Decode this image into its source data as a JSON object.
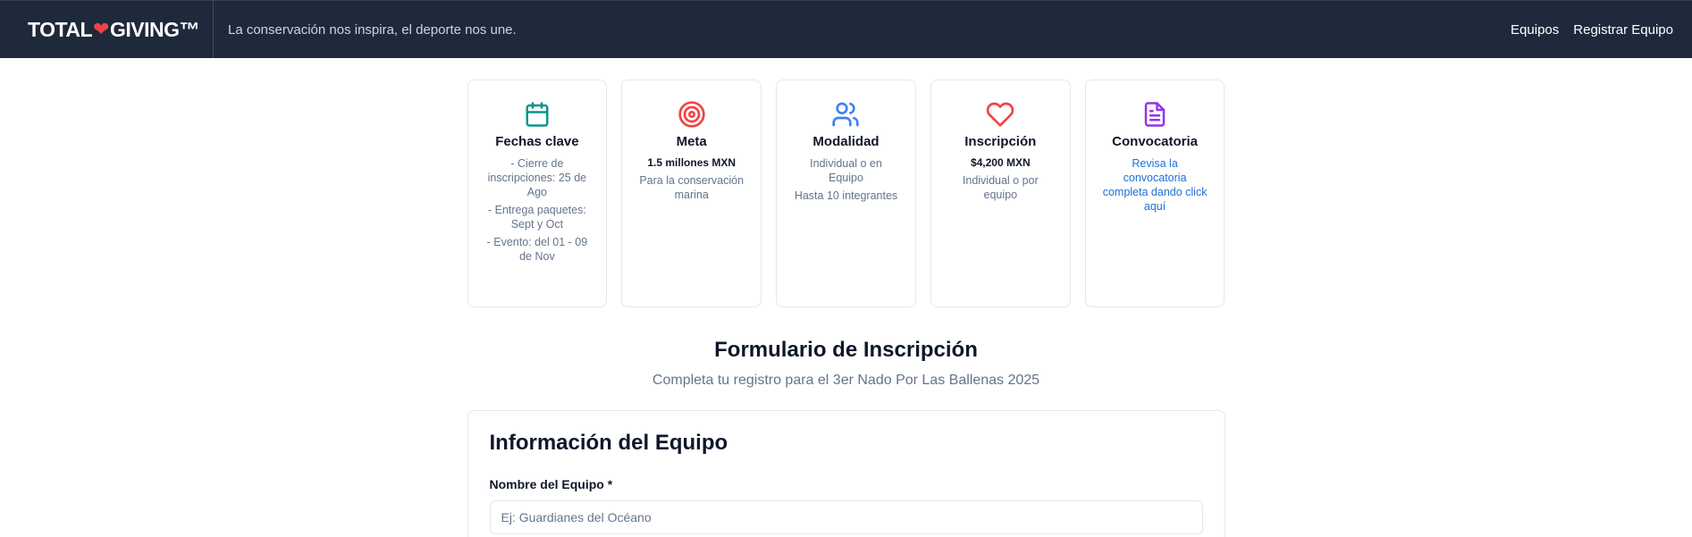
{
  "navbar": {
    "brand_left": "TOTAL",
    "brand_heart": "❤",
    "brand_right": "GIVING™",
    "tagline": "La conservación nos inspira, el deporte nos une.",
    "links": [
      "Equipos",
      "Registrar Equipo"
    ]
  },
  "cards": [
    {
      "icon": "calendar-icon",
      "color": "#0d9488",
      "title": "Fechas clave",
      "lines": [
        "- Cierre de inscripciones: 25 de Ago",
        "- Entrega paquetes: Sept y Oct",
        "- Evento: del 01 - 09 de Nov"
      ]
    },
    {
      "icon": "target-icon",
      "color": "#ef4444",
      "title": "Meta",
      "strong": "1.5 millones MXN",
      "lines": [
        "Para la conservación marina"
      ]
    },
    {
      "icon": "users-icon",
      "color": "#3b82f6",
      "title": "Modalidad",
      "lines": [
        "Individual o en Equipo",
        "Hasta 10 integrantes"
      ]
    },
    {
      "icon": "heart-icon",
      "color": "#ef4444",
      "title": "Inscripción",
      "strong": "$4,200 MXN",
      "lines": [
        "Individual o por equipo"
      ]
    },
    {
      "icon": "document-icon",
      "color": "#9333ea",
      "title": "Convocatoria",
      "link": "Revisa la convocatoria completa dando click aquí"
    }
  ],
  "form": {
    "title": "Formulario de Inscripción",
    "subtitle": "Completa tu registro para el 3er Nado Por Las Ballenas 2025",
    "section_title": "Información del Equipo",
    "team_name_label": "Nombre del Equipo *",
    "team_name_placeholder": "Ej: Guardianes del Océano",
    "team_name_value": ""
  }
}
